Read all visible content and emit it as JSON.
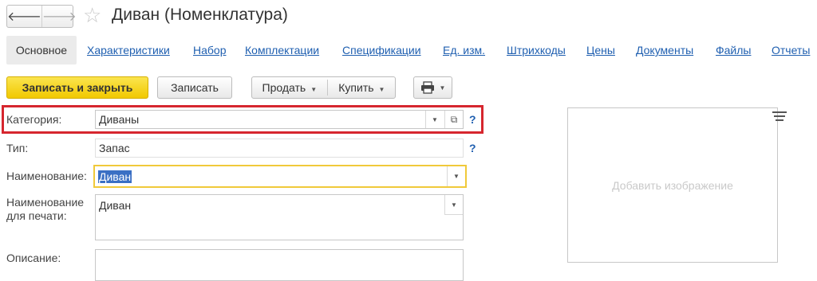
{
  "window": {
    "title": "Диван (Номенклатура)"
  },
  "nav": {
    "back_icon": "arrow-left-icon",
    "forward_icon": "arrow-right-icon",
    "favorite_icon": "star-icon"
  },
  "tabs": [
    {
      "label": "Основное",
      "active": true
    },
    {
      "label": "Характеристики"
    },
    {
      "label": "Набор"
    },
    {
      "label": "Комплектации"
    },
    {
      "label": "Спецификации"
    },
    {
      "label": "Ед. изм."
    },
    {
      "label": "Штрихкоды"
    },
    {
      "label": "Цены"
    },
    {
      "label": "Документы"
    },
    {
      "label": "Файлы"
    },
    {
      "label": "Отчеты"
    }
  ],
  "toolbar": {
    "save_close_label": "Записать и закрыть",
    "save_label": "Записать",
    "sell_label": "Продать",
    "buy_label": "Купить",
    "print_icon": "printer-icon",
    "primary_color": "#f5d31e"
  },
  "form": {
    "category": {
      "label": "Категория:",
      "value": "Диваны",
      "help": "?"
    },
    "type": {
      "label": "Тип:",
      "value": "Запас",
      "help": "?"
    },
    "name": {
      "label": "Наименование:",
      "value": "Диван"
    },
    "print_name": {
      "label_line1": "Наименование",
      "label_line2": "для печати:",
      "value": "Диван"
    },
    "description": {
      "label": "Описание:",
      "value": ""
    }
  },
  "image_panel": {
    "placeholder": "Добавить изображение"
  },
  "highlight_color": "#d6262e"
}
